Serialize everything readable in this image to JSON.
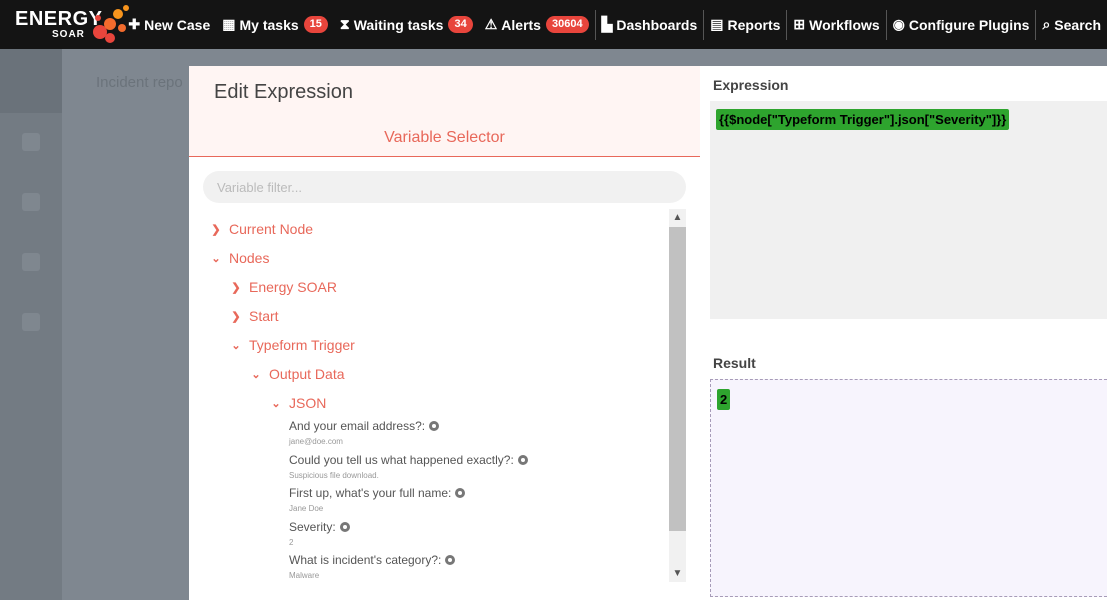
{
  "app": {
    "logo_word1": "ENERGY",
    "logo_word2": "SOAR",
    "accent": "#e8685a",
    "highlight": "#2ea42e"
  },
  "nav": [
    {
      "label": "New Case",
      "icon": "plus-icon"
    },
    {
      "label": "My tasks",
      "icon": "tasks-icon",
      "badge": "15"
    },
    {
      "label": "Waiting tasks",
      "icon": "hourglass-icon",
      "badge": "34"
    },
    {
      "label": "Alerts",
      "icon": "warning-icon",
      "badge": "30604"
    },
    {
      "label": "Dashboards",
      "icon": "bar-chart-icon"
    },
    {
      "label": "Reports",
      "icon": "file-icon"
    },
    {
      "label": "Workflows",
      "icon": "sitemap-icon"
    },
    {
      "label": "Configure Plugins",
      "icon": "brain-icon"
    },
    {
      "label": "Search",
      "icon": "search-icon"
    }
  ],
  "background": {
    "page_text": "Incident repo"
  },
  "modal": {
    "title": "Edit Expression",
    "selector_title": "Variable Selector",
    "filter_placeholder": "Variable filter...",
    "tree": {
      "current_node": "Current Node",
      "nodes": "Nodes",
      "energy_soar": "Energy SOAR",
      "start": "Start",
      "typeform_trigger": "Typeform Trigger",
      "output_data": "Output Data",
      "json": "JSON",
      "fields": [
        {
          "name": "And your email address?:",
          "value": "jane@doe.com"
        },
        {
          "name": "Could you tell us what happened exactly?:",
          "value": "Suspicious file download."
        },
        {
          "name": "First up, what's your full name:",
          "value": "Jane Doe"
        },
        {
          "name": "Severity:",
          "value": "2"
        },
        {
          "name": "What is incident's category?:",
          "value": "Malware"
        }
      ]
    },
    "expression_label": "Expression",
    "expression_value": "{{$node[\"Typeform Trigger\"].json[\"Severity\"]}}",
    "result_label": "Result",
    "result_value": "2"
  }
}
